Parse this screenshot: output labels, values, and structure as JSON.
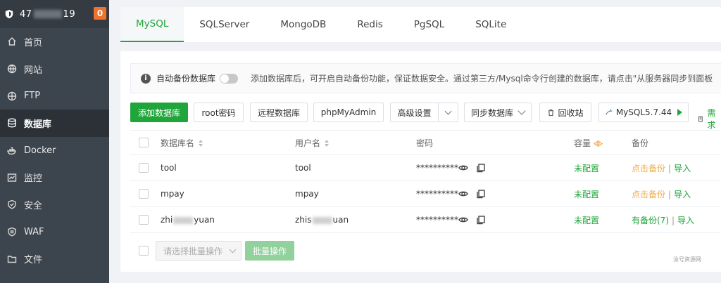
{
  "sidebar": {
    "host_prefix": "47",
    "host_suffix": "19",
    "badge": "0",
    "items": [
      {
        "label": "首页",
        "icon": "home-icon"
      },
      {
        "label": "网站",
        "icon": "globe-icon"
      },
      {
        "label": "FTP",
        "icon": "ftp-icon"
      },
      {
        "label": "数据库",
        "icon": "database-icon"
      },
      {
        "label": "Docker",
        "icon": "docker-icon"
      },
      {
        "label": "监控",
        "icon": "monitor-icon"
      },
      {
        "label": "安全",
        "icon": "shield-icon"
      },
      {
        "label": "WAF",
        "icon": "waf-icon"
      },
      {
        "label": "文件",
        "icon": "folder-icon"
      }
    ]
  },
  "tabs": [
    "MySQL",
    "SQLServer",
    "MongoDB",
    "Redis",
    "PgSQL",
    "SQLite"
  ],
  "notice": {
    "label": "自动备份数据库",
    "text": "添加数据库后，可开启自动备份功能，保证数据安全。通过第三方/Mysql命令行创建的数据库，请点击\"从服务器同步到面板"
  },
  "toolbar": {
    "add": "添加数据库",
    "root": "root密码",
    "remote": "远程数据库",
    "pma": "phpMyAdmin",
    "advanced": "高级设置",
    "sync": "同步数据库",
    "recycle": "回收站",
    "mysql_version": "MySQL5.7.44",
    "need": "需求"
  },
  "table": {
    "headers": {
      "name": "数据库名",
      "user": "用户名",
      "password": "密码",
      "capacity": "容量",
      "backup": "备份"
    },
    "rows": [
      {
        "name": "tool",
        "user": "tool",
        "password": "**********",
        "capacity": "未配置",
        "backup": "点击备份",
        "import": "导入"
      },
      {
        "name": "mpay",
        "user": "mpay",
        "password": "**********",
        "capacity": "未配置",
        "backup": "点击备份",
        "import": "导入"
      },
      {
        "name_a": "zhi",
        "name_b": "yuan",
        "user_a": "zhis",
        "user_b": "uan",
        "password": "**********",
        "capacity": "未配置",
        "backup": "有备份(7)",
        "import": "导入"
      }
    ]
  },
  "footer": {
    "select_placeholder": "请选择批量操作",
    "batch_button": "批量操作"
  },
  "watermark": "泳号资源网",
  "colors": {
    "accent": "#20a53a",
    "sidebar": "#3c444d",
    "orange": "#f0ad4e",
    "badge": "#f0722c"
  }
}
